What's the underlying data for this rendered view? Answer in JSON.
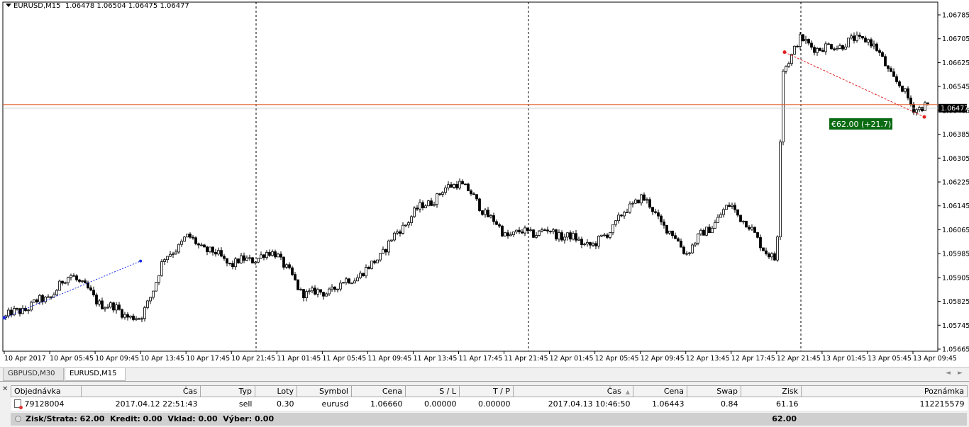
{
  "chart": {
    "symbol_header": "EURUSD,M15",
    "ohlc_header": "1.06478 1.06504 1.06475 1.06477",
    "price_axis": [
      "1.06785",
      "1.06705",
      "1.06625",
      "1.06545",
      "1.06465",
      "1.06385",
      "1.06305",
      "1.06225",
      "1.06145",
      "1.06065",
      "1.05985",
      "1.05905",
      "1.05825",
      "1.05745",
      "1.05665"
    ],
    "current_price_label": "1.06477",
    "time_axis": [
      "10 Apr 2017",
      "10 Apr 05:45",
      "10 Apr 09:45",
      "10 Apr 13:45",
      "10 Apr 17:45",
      "10 Apr 21:45",
      "11 Apr 01:45",
      "11 Apr 05:45",
      "11 Apr 09:45",
      "11 Apr 13:45",
      "11 Apr 17:45",
      "11 Apr 21:45",
      "12 Apr 01:45",
      "12 Apr 05:45",
      "12 Apr 09:45",
      "12 Apr 13:45",
      "12 Apr 17:45",
      "12 Apr 21:45",
      "13 Apr 01:45",
      "13 Apr 05:45",
      "13 Apr 09:45"
    ],
    "trade_profit_label": "€62.00 (+21.7)",
    "colors": {
      "bid_line": "#e06030",
      "trade_label_bg": "#0a6b12",
      "sell_line": "#e02020",
      "history_line": "#1e2ee0"
    }
  },
  "chart_data": {
    "type": "candlestick",
    "symbol": "EURUSD",
    "timeframe": "M15",
    "ylim": [
      1.05665,
      1.06785
    ],
    "x_start": "10 Apr 2017",
    "x_end": "13 Apr 09:45",
    "waypoints": [
      {
        "time": "10 Apr 2017",
        "price": 1.0577
      },
      {
        "time": "10 Apr 05:45",
        "price": 1.0584
      },
      {
        "time": "10 Apr 07:45",
        "price": 1.0592
      },
      {
        "time": "10 Apr 09:45",
        "price": 1.0583
      },
      {
        "time": "10 Apr 13:45",
        "price": 1.0576
      },
      {
        "time": "10 Apr 15:45",
        "price": 1.0596
      },
      {
        "time": "10 Apr 17:45",
        "price": 1.0604
      },
      {
        "time": "10 Apr 21:45",
        "price": 1.0595
      },
      {
        "time": "11 Apr 01:45",
        "price": 1.0599
      },
      {
        "time": "11 Apr 03:45",
        "price": 1.0586
      },
      {
        "time": "11 Apr 05:45",
        "price": 1.0585
      },
      {
        "time": "11 Apr 09:45",
        "price": 1.0593
      },
      {
        "time": "11 Apr 13:45",
        "price": 1.0612
      },
      {
        "time": "11 Apr 17:45",
        "price": 1.0623
      },
      {
        "time": "11 Apr 21:45",
        "price": 1.0605
      },
      {
        "time": "12 Apr 01:45",
        "price": 1.0606
      },
      {
        "time": "12 Apr 05:45",
        "price": 1.0601
      },
      {
        "time": "12 Apr 09:45",
        "price": 1.0618
      },
      {
        "time": "12 Apr 13:45",
        "price": 1.0599
      },
      {
        "time": "12 Apr 17:45",
        "price": 1.0615
      },
      {
        "time": "12 Apr 21:45",
        "price": 1.0595
      },
      {
        "time": "12 Apr 22:15",
        "price": 1.066
      },
      {
        "time": "12 Apr 23:45",
        "price": 1.067
      },
      {
        "time": "13 Apr 01:45",
        "price": 1.0667
      },
      {
        "time": "13 Apr 05:45",
        "price": 1.0671
      },
      {
        "time": "13 Apr 09:45",
        "price": 1.06477
      }
    ],
    "trade": {
      "open_time": "2017.04.12 22:51:43",
      "open_price": 1.0666,
      "close_time": "2017.04.13 10:46:50",
      "close_price": 1.06443,
      "type": "sell"
    },
    "history_line": {
      "from_time": "10 Apr 2017",
      "from_price": 1.0577,
      "to_time": "10 Apr 13:45",
      "to_price": 1.0596
    }
  },
  "tabs": [
    {
      "label": "GBPUSD,M30",
      "active": false
    },
    {
      "label": "EURUSD,M15",
      "active": true
    }
  ],
  "terminal": {
    "columns": [
      "Objednávka",
      "Čas",
      "Typ",
      "Loty",
      "Symbol",
      "Cena",
      "S / L",
      "T / P",
      "Čas",
      "Cena",
      "Swap",
      "Zisk",
      "Poznámka"
    ],
    "row": {
      "order": "79128004",
      "open_time": "2017.04.12 22:51:43",
      "type": "sell",
      "lots": "0.30",
      "symbol": "eurusd",
      "open_price": "1.06660",
      "sl": "0.00000",
      "tp": "0.00000",
      "close_time": "2017.04.13 10:46:50",
      "close_price": "1.06443",
      "swap": "0.84",
      "profit": "61.16",
      "comment": "112215579"
    },
    "summary": "Zisk/Strata: 62.00  Kredit: 0.00  Vklad: 0.00  Výber: 0.00",
    "summary_profit": "62.00"
  }
}
